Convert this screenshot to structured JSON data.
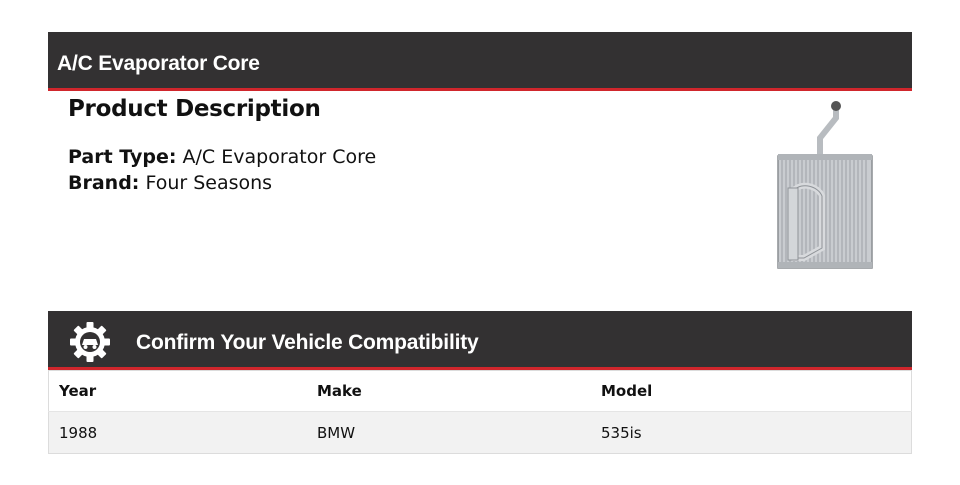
{
  "header": {
    "title": "A/C Evaporator Core"
  },
  "description": {
    "heading": "Product Description",
    "part_type_label": "Part Type:",
    "part_type_value": "A/C Evaporator Core",
    "brand_label": "Brand:",
    "brand_value": "Four Seasons"
  },
  "product_image": {
    "icon": "evaporator-core-image"
  },
  "compatibility": {
    "title": "Confirm Your Vehicle Compatibility",
    "icon": "gear-car-icon",
    "columns": [
      "Year",
      "Make",
      "Model"
    ],
    "rows": [
      {
        "year": "1988",
        "make": "BMW",
        "model": "535is"
      }
    ]
  },
  "colors": {
    "bar_bg": "#333132",
    "accent": "#d0262c",
    "row_bg": "#f2f2f2"
  }
}
